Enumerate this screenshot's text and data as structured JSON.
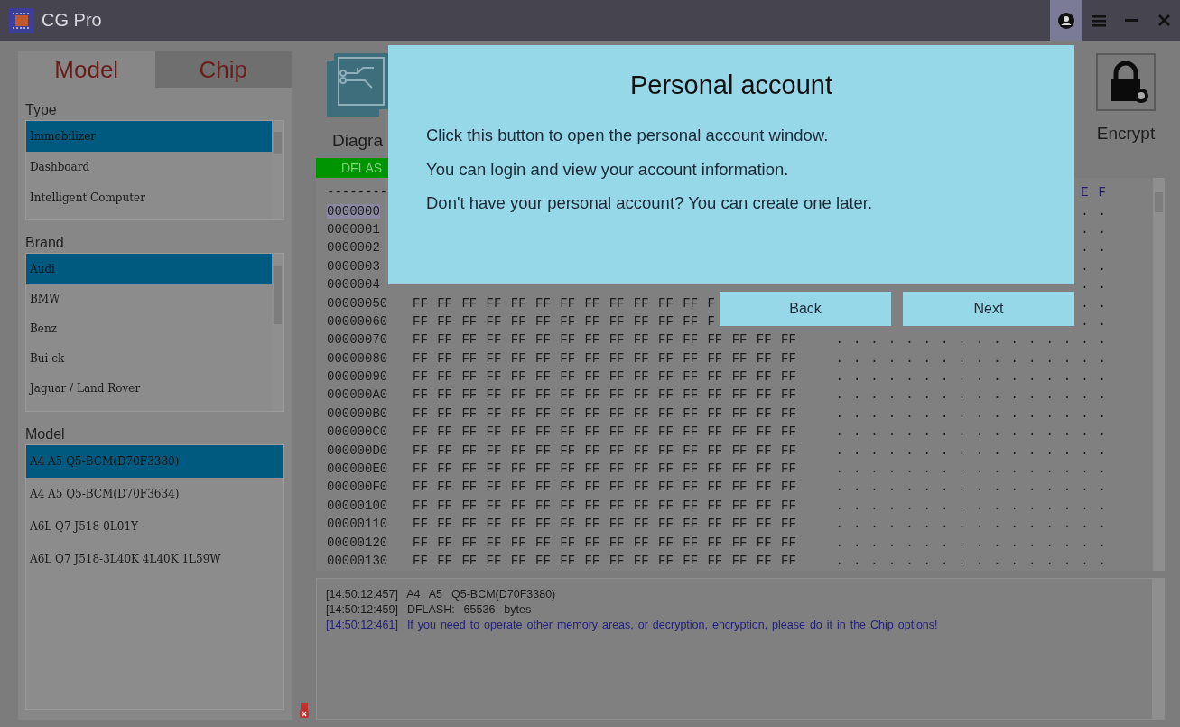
{
  "window": {
    "title": "CG Pro"
  },
  "titlebar_buttons": [
    {
      "kind": "account",
      "highlighted": true
    },
    {
      "kind": "menu",
      "highlighted": false
    },
    {
      "kind": "minimize",
      "highlighted": false
    },
    {
      "kind": "close",
      "highlighted": false
    }
  ],
  "side_tabs": [
    {
      "label": "Model",
      "selected": true
    },
    {
      "label": "Chip",
      "selected": false
    }
  ],
  "lists": [
    {
      "label": "Type",
      "items": [
        {
          "label": "Immobilizer",
          "selected": true
        },
        {
          "label": "Dashboard",
          "selected": false
        },
        {
          "label": "Intelligent Computer",
          "selected": false
        }
      ]
    },
    {
      "label": "Brand",
      "items": [
        {
          "label": "Audi",
          "selected": true
        },
        {
          "label": "BMW",
          "selected": false
        },
        {
          "label": "Benz",
          "selected": false
        },
        {
          "label": "Bui ck",
          "selected": false
        },
        {
          "label": "Jaguar / Land Rover",
          "selected": false
        }
      ]
    },
    {
      "label": "Model",
      "items": [
        {
          "label": "A4 A5 Q5-BCM(D70F3380)",
          "selected": true
        },
        {
          "label": "A4 A5 Q5-BCM(D70F3634)",
          "selected": false
        },
        {
          "label": "A6L Q7 J518-0L01Y",
          "selected": false
        },
        {
          "label": "A6L Q7 J518-3L40K 4L40K 1L59W",
          "selected": false
        }
      ]
    }
  ],
  "toolbar": [
    {
      "kind": "diagram",
      "label": "Diagra"
    },
    {
      "kind": "encrypt",
      "label": "Encrypt"
    }
  ],
  "memory_tabs": [
    {
      "label": "DFLAS",
      "selected": true
    }
  ],
  "hex": {
    "header_left": "--------",
    "header_right": "E F",
    "rows": [
      {
        "address": "0000000",
        "bytes": "",
        "ascii": ". .",
        "selected": true
      },
      {
        "address": "0000001",
        "bytes": "",
        "ascii": ". .",
        "selected": false
      },
      {
        "address": "0000002",
        "bytes": "",
        "ascii": ". .",
        "selected": false
      },
      {
        "address": "0000003",
        "bytes": "",
        "ascii": ". .",
        "selected": false
      },
      {
        "address": "0000004",
        "bytes": "",
        "ascii": ". .",
        "selected": false
      },
      {
        "address": "00000050",
        "bytes": "FF FF FF FF FF FF FF FF FF FF FF FF F",
        "ascii": ". .",
        "selected": false
      },
      {
        "address": "00000060",
        "bytes": "FF FF FF FF FF FF FF FF FF FF FF FF F",
        "ascii": ". .",
        "selected": false
      },
      {
        "address": "00000070",
        "bytes": "FF FF FF FF FF FF FF FF FF FF FF FF FF FF FF FF",
        "ascii": ". . . . . . . . . . . . . . . .",
        "selected": false
      },
      {
        "address": "00000080",
        "bytes": "FF FF FF FF FF FF FF FF FF FF FF FF FF FF FF FF",
        "ascii": ". . . . . . . . . . . . . . . .",
        "selected": false
      },
      {
        "address": "00000090",
        "bytes": "FF FF FF FF FF FF FF FF FF FF FF FF FF FF FF FF",
        "ascii": ". . . . . . . . . . . . . . . .",
        "selected": false
      },
      {
        "address": "000000A0",
        "bytes": "FF FF FF FF FF FF FF FF FF FF FF FF FF FF FF FF",
        "ascii": ". . . . . . . . . . . . . . . .",
        "selected": false
      },
      {
        "address": "000000B0",
        "bytes": "FF FF FF FF FF FF FF FF FF FF FF FF FF FF FF FF",
        "ascii": ". . . . . . . . . . . . . . . .",
        "selected": false
      },
      {
        "address": "000000C0",
        "bytes": "FF FF FF FF FF FF FF FF FF FF FF FF FF FF FF FF",
        "ascii": ". . . . . . . . . . . . . . . .",
        "selected": false
      },
      {
        "address": "000000D0",
        "bytes": "FF FF FF FF FF FF FF FF FF FF FF FF FF FF FF FF",
        "ascii": ". . . . . . . . . . . . . . . .",
        "selected": false
      },
      {
        "address": "000000E0",
        "bytes": "FF FF FF FF FF FF FF FF FF FF FF FF FF FF FF FF",
        "ascii": ". . . . . . . . . . . . . . . .",
        "selected": false
      },
      {
        "address": "000000F0",
        "bytes": "FF FF FF FF FF FF FF FF FF FF FF FF FF FF FF FF",
        "ascii": ". . . . . . . . . . . . . . . .",
        "selected": false
      },
      {
        "address": "00000100",
        "bytes": "FF FF FF FF FF FF FF FF FF FF FF FF FF FF FF FF",
        "ascii": ". . . . . . . . . . . . . . . .",
        "selected": false
      },
      {
        "address": "00000110",
        "bytes": "FF FF FF FF FF FF FF FF FF FF FF FF FF FF FF FF",
        "ascii": ". . . . . . . . . . . . . . . .",
        "selected": false
      },
      {
        "address": "00000120",
        "bytes": "FF FF FF FF FF FF FF FF FF FF FF FF FF FF FF FF",
        "ascii": ". . . . . . . . . . . . . . . .",
        "selected": false
      },
      {
        "address": "00000130",
        "bytes": "FF FF FF FF FF FF FF FF FF FF FF FF FF FF FF FF",
        "ascii": ". . . . . . . . . . . . . . . .",
        "selected": false
      }
    ]
  },
  "log": [
    {
      "time": "[14:50:12:457]",
      "text": "A4  A5  Q5-BCM(D70F3380)",
      "kind": "info"
    },
    {
      "time": "[14:50:12:459]",
      "text": "DFLASH:  65536  bytes",
      "kind": "info"
    },
    {
      "time": "[14:50:12:461]",
      "text": "If you need to operate other memory areas, or decryption, encryption, please do it in the Chip options!",
      "kind": "hint"
    }
  ],
  "tour": {
    "title": "Personal account",
    "lines": [
      "Click this button to open the personal account window.",
      "You can login and view your account information.",
      "Don't have your personal account? You can create one later."
    ],
    "buttons": [
      {
        "label": "Back"
      },
      {
        "label": "Next"
      }
    ]
  }
}
